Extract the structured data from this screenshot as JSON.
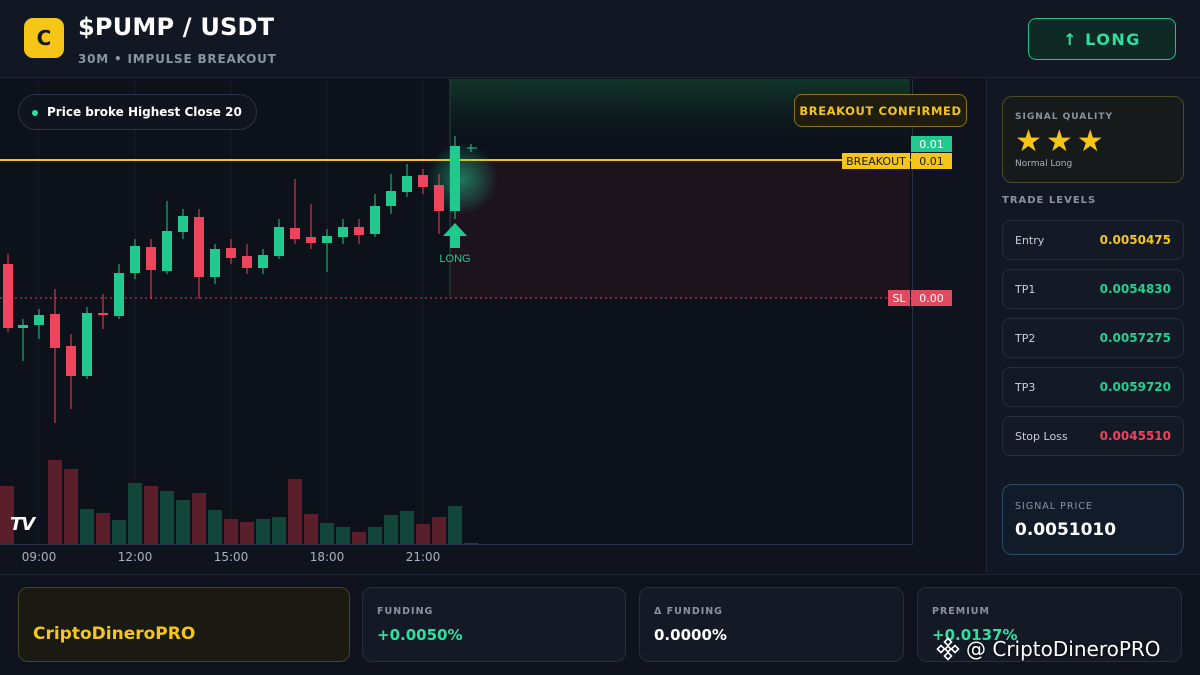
{
  "header": {
    "logo_letter": "C",
    "pair": "$PUMP / USDT",
    "subtitle": "30M • IMPULSE BREAKOUT",
    "direction_button": "↑ LONG"
  },
  "chart": {
    "info_chip": "Price broke Highest Close 20",
    "status_badge": "BREAKOUT CONFIRMED",
    "signal_marker": "LONG",
    "watermark_logo": "TV",
    "time_ticks": [
      "09:00",
      "12:00",
      "15:00",
      "18:00",
      "21:00"
    ],
    "price_tags": {
      "current": "0.01",
      "breakout_label": "BREAKOUT",
      "breakout_value": "0.01",
      "sl_label": "SL",
      "sl_value": "0.00"
    },
    "colors": {
      "up": "#22c98e",
      "down": "#f0435d",
      "breakout_line": "#f5c518",
      "sl_line": "#d9485e"
    }
  },
  "signal_quality": {
    "label": "SIGNAL QUALITY",
    "stars": "★★★",
    "rating": 3,
    "sub": "Normal Long"
  },
  "trade_levels": {
    "title": "TRADE LEVELS",
    "rows": [
      {
        "name": "Entry",
        "value": "0.0050475",
        "color": "#f5c518"
      },
      {
        "name": "TP1",
        "value": "0.0054830",
        "color": "#22d08f"
      },
      {
        "name": "TP2",
        "value": "0.0057275",
        "color": "#22d08f"
      },
      {
        "name": "TP3",
        "value": "0.0059720",
        "color": "#22d08f"
      },
      {
        "name": "Stop Loss",
        "value": "0.0045510",
        "color": "#f0435d"
      }
    ]
  },
  "signal_price": {
    "label": "SIGNAL PRICE",
    "value": "0.0051010"
  },
  "footer": {
    "brand": "CriptoDineroPRO",
    "stats": [
      {
        "label": "FUNDING",
        "value": "+0.0050%",
        "color": "#2ee0a0"
      },
      {
        "label": "Δ FUNDING",
        "value": "0.0000%",
        "color": "#ffffff"
      },
      {
        "label": "PREMIUM",
        "value": "+0.0137%",
        "color": "#2ee0a0"
      }
    ],
    "watermark": "@ CriptoDineroPRO"
  }
}
